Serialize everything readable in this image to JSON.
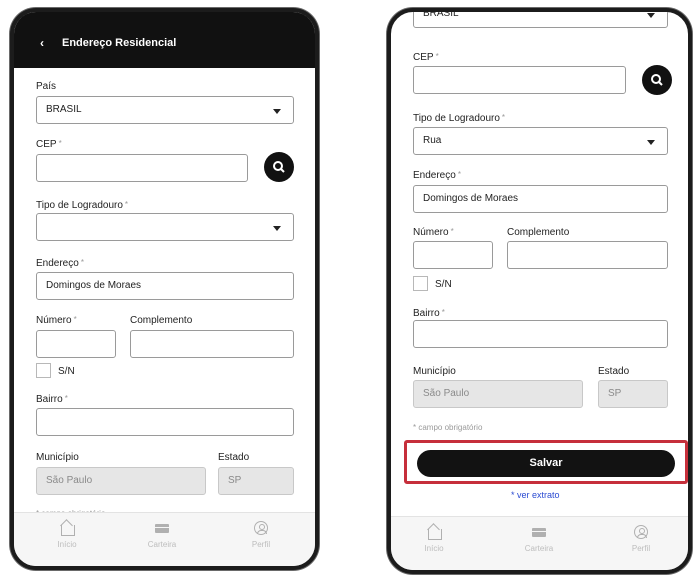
{
  "screen1": {
    "header": {
      "back_glyph": "‹",
      "title": "Endereço Residencial"
    },
    "pais": {
      "label": "País",
      "value": "BRASIL"
    },
    "cep": {
      "label": "CEP",
      "value": ""
    },
    "tipo_logradouro": {
      "label": "Tipo de Logradouro",
      "value": ""
    },
    "endereco": {
      "label": "Endereço",
      "value": "Domingos de Moraes"
    },
    "numero": {
      "label": "Número",
      "value": ""
    },
    "complemento": {
      "label": "Complemento",
      "value": ""
    },
    "sn": {
      "label": "S/N"
    },
    "bairro": {
      "label": "Bairro",
      "value": ""
    },
    "municipio": {
      "label": "Município",
      "value": "São Paulo"
    },
    "estado": {
      "label": "Estado",
      "value": "SP"
    },
    "required_note": "campo obrigatório",
    "nav": {
      "inicio": "Início",
      "carteira": "Carteira",
      "perfil": "Perfil"
    }
  },
  "screen2": {
    "pais": {
      "value": "BRASIL"
    },
    "cep": {
      "label": "CEP",
      "value": ""
    },
    "tipo_logradouro": {
      "label": "Tipo de Logradouro",
      "value": "Rua"
    },
    "endereco": {
      "label": "Endereço",
      "value": "Domingos de Moraes"
    },
    "numero": {
      "label": "Número",
      "value": ""
    },
    "complemento": {
      "label": "Complemento",
      "value": ""
    },
    "sn": {
      "label": "S/N"
    },
    "bairro": {
      "label": "Bairro",
      "value": ""
    },
    "municipio": {
      "label": "Município",
      "value": "São Paulo"
    },
    "estado": {
      "label": "Estado",
      "value": "SP"
    },
    "required_note": "campo obrigatório",
    "save_label": "Salvar",
    "ver_extrato": "ver extrato",
    "nav": {
      "inicio": "Início",
      "carteira": "Carteira",
      "perfil": "Perfil"
    }
  },
  "required_marker": "*",
  "colors": {
    "header_bg": "#111111",
    "primary_button": "#121212",
    "highlight_border": "#c62f3b",
    "link": "#2b4bd2",
    "disabled_field": "#e6e6e6"
  },
  "icons": [
    "back-chevron-icon",
    "search-icon",
    "chevron-down-icon",
    "home-icon",
    "wallet-icon",
    "profile-icon"
  ]
}
